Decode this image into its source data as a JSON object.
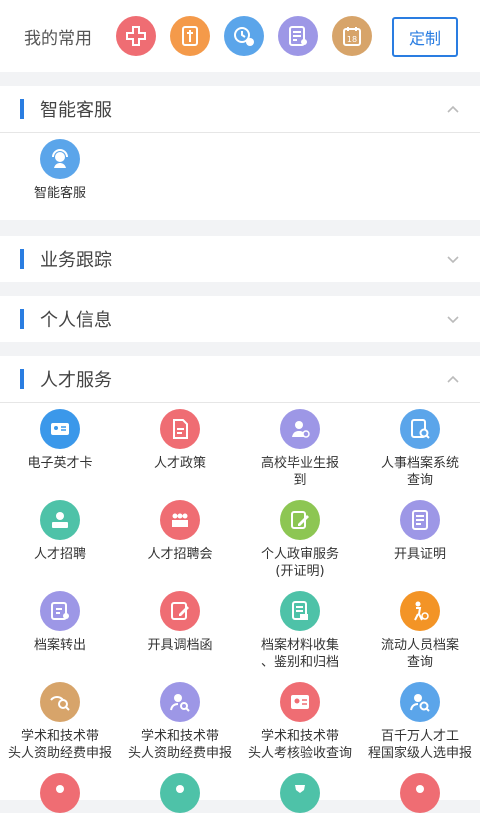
{
  "top": {
    "label": "我的常用",
    "custom_button": "定制",
    "favorites": [
      {
        "icon": "medical-cross-icon",
        "color": "#ef6d73"
      },
      {
        "icon": "document-icon",
        "color": "#f49a4a"
      },
      {
        "icon": "chat-clock-icon",
        "color": "#5ba5ea"
      },
      {
        "icon": "checklist-icon",
        "color": "#9d97e6"
      },
      {
        "icon": "calendar-icon",
        "color": "#d7a46a",
        "text": "18"
      }
    ]
  },
  "sections": {
    "smart_service": {
      "title": "智能客服",
      "items": [
        {
          "label": "智能客服",
          "icon": "agent-icon",
          "color": "#5ba5ea"
        }
      ]
    },
    "business_tracking": {
      "title": "业务跟踪"
    },
    "personal_info": {
      "title": "个人信息"
    },
    "talent_service": {
      "title": "人才服务",
      "items": [
        {
          "label": "电子英才卡",
          "icon": "id-card-icon",
          "color": "#3b98ea"
        },
        {
          "label": "人才政策",
          "icon": "policy-doc-icon",
          "color": "#ef6d73"
        },
        {
          "label": "高校毕业生报\n到",
          "icon": "graduate-icon",
          "color": "#9d97e6"
        },
        {
          "label": "人事档案系统\n查询",
          "icon": "archive-search-icon",
          "color": "#5ba5ea"
        },
        {
          "label": "人才招聘",
          "icon": "recruit-icon",
          "color": "#4ec2a8"
        },
        {
          "label": "人才招聘会",
          "icon": "job-fair-icon",
          "color": "#ef6d73"
        },
        {
          "label": "个人政审服务\n(开证明)",
          "icon": "edit-doc-icon",
          "color": "#8dc653"
        },
        {
          "label": "开具证明",
          "icon": "certificate-icon",
          "color": "#9d97e6"
        },
        {
          "label": "档案转出",
          "icon": "transfer-icon",
          "color": "#9d97e6"
        },
        {
          "label": "开具调档函",
          "icon": "letter-icon",
          "color": "#ef6d73"
        },
        {
          "label": "档案材料收集\n、鉴别和归档",
          "icon": "file-collect-icon",
          "color": "#4ec2a8"
        },
        {
          "label": "流动人员档案\n查询",
          "icon": "mobile-person-icon",
          "color": "#f39426"
        },
        {
          "label": "学术和技术带\n头人资助经费申报",
          "icon": "funding-search-icon",
          "color": "#d7a46a"
        },
        {
          "label": "学术和技术带\n头人资助经费申报",
          "icon": "person-search-icon",
          "color": "#9d97e6"
        },
        {
          "label": "学术和技术带\n头人考核验收查询",
          "icon": "person-card-icon",
          "color": "#ef6d73"
        },
        {
          "label": "百千万人才工\n程国家级人选申报",
          "icon": "person-magnify-icon",
          "color": "#5ba5ea"
        },
        {
          "label": "",
          "icon": "person-tie-icon",
          "color": "#ef6d73"
        },
        {
          "label": "",
          "icon": "person-badge-icon",
          "color": "#4ec2a8"
        },
        {
          "label": "",
          "icon": "trophy-icon",
          "color": "#4ec2a8"
        },
        {
          "label": "",
          "icon": "person-doc-icon",
          "color": "#ef6d73"
        }
      ]
    }
  }
}
